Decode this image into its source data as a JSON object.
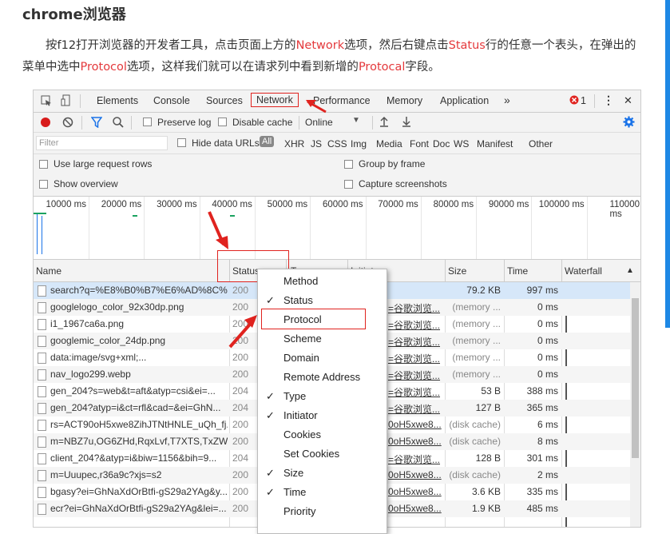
{
  "article": {
    "title": "chrome浏览器",
    "para": [
      {
        "t": "按f12打开浏览器的开发者工具，点击页面上方的",
        "hl": false
      },
      {
        "t": "Network",
        "hl": true
      },
      {
        "t": "选项，然后右键点击",
        "hl": false
      },
      {
        "t": "Status",
        "hl": true
      },
      {
        "t": "行的任意一个表头，在弹出的菜单中选中",
        "hl": false
      },
      {
        "t": "Protocol",
        "hl": true
      },
      {
        "t": "选项，这样我们就可以在请求列中看到新增的",
        "hl": false
      },
      {
        "t": "Protocal",
        "hl": true
      },
      {
        "t": "字段。",
        "hl": false
      }
    ]
  },
  "devtools": {
    "tabs": [
      "Elements",
      "Console",
      "Sources",
      "Network",
      "Performance",
      "Memory",
      "Application"
    ],
    "more_tabs": "»",
    "error_count": "1",
    "menu_icon": "⋮",
    "close_icon": "✕",
    "toolbar": {
      "preserve_log": "Preserve log",
      "disable_cache": "Disable cache",
      "throttle": "Online"
    },
    "filter": {
      "placeholder": "Filter",
      "hide_data_urls": "Hide data URLs",
      "all": "All",
      "types": [
        "XHR",
        "JS",
        "CSS",
        "Img",
        "Media",
        "Font",
        "Doc",
        "WS",
        "Manifest",
        "Other"
      ]
    },
    "options": {
      "large_rows": "Use large request rows",
      "show_overview": "Show overview",
      "group_by_frame": "Group by frame",
      "capture_screenshots": "Capture screenshots"
    },
    "ticks": [
      "10000 ms",
      "20000 ms",
      "30000 ms",
      "40000 ms",
      "50000 ms",
      "60000 ms",
      "70000 ms",
      "80000 ms",
      "90000 ms",
      "100000 ms",
      "110000 ms"
    ],
    "columns": {
      "name": "Name",
      "status": "Status",
      "type": "Ty",
      "initiator": "Initiator",
      "size": "Size",
      "time": "Time",
      "waterfall": "Waterfall"
    },
    "rows": [
      {
        "name": "search?q=%E8%B0%B7%E6%AD%8C%...",
        "status": "200",
        "init": "",
        "size": "79.2 KB",
        "time": "997 ms"
      },
      {
        "name": "googlelogo_color_92x30dp.png",
        "status": "200",
        "init": "=谷歌浏览...",
        "size": "(memory ...",
        "time": "0 ms"
      },
      {
        "name": "i1_1967ca6a.png",
        "status": "200",
        "init": "=谷歌浏览...",
        "size": "(memory ...",
        "time": "0 ms"
      },
      {
        "name": "googlemic_color_24dp.png",
        "status": "200",
        "init": "=谷歌浏览...",
        "size": "(memory ...",
        "time": "0 ms"
      },
      {
        "name": "data:image/svg+xml;...",
        "status": "200",
        "init": "=谷歌浏览...",
        "size": "(memory ...",
        "time": "0 ms"
      },
      {
        "name": "nav_logo299.webp",
        "status": "200",
        "init": "=谷歌浏览...",
        "size": "(memory ...",
        "time": "0 ms"
      },
      {
        "name": "gen_204?s=web&t=aft&atyp=csi&ei=...",
        "status": "204",
        "init": "=谷歌浏览...",
        "size": "53 B",
        "time": "388 ms"
      },
      {
        "name": "gen_204?atyp=i&ct=rfl&cad=&ei=GhN...",
        "status": "204",
        "init": "=谷歌浏览...",
        "size": "127 B",
        "time": "365 ms"
      },
      {
        "name": "rs=ACT90oH5xwe8ZihJTNtHNLE_uQh_fj...",
        "status": "200",
        "init": "0oH5xwe8...",
        "size": "(disk cache)",
        "time": "6 ms"
      },
      {
        "name": "m=NBZ7u,OG6ZHd,RqxLvf,T7XTS,TxZW...",
        "status": "200",
        "init": "0oH5xwe8...",
        "size": "(disk cache)",
        "time": "8 ms"
      },
      {
        "name": "client_204?&atyp=i&biw=1156&bih=9...",
        "status": "204",
        "init": "=谷歌浏览...",
        "size": "128 B",
        "time": "301 ms"
      },
      {
        "name": "m=Uuupec,r36a9c?xjs=s2",
        "status": "200",
        "init": "0oH5xwe8...",
        "size": "(disk cache)",
        "time": "2 ms"
      },
      {
        "name": "bgasy?ei=GhNaXdOrBtfi-gS29a2YAg&y...",
        "status": "200",
        "init": "0oH5xwe8...",
        "size": "3.6 KB",
        "time": "335 ms"
      },
      {
        "name": "ecr?ei=GhNaXdOrBtfi-gS29a2YAg&lei=...",
        "status": "200",
        "init": "0oH5xwe8...",
        "size": "1.9 KB",
        "time": "485 ms"
      }
    ]
  },
  "context_menu": [
    {
      "label": "Method",
      "checked": false
    },
    {
      "label": "Status",
      "checked": true
    },
    {
      "label": "Protocol",
      "checked": false
    },
    {
      "label": "Scheme",
      "checked": false
    },
    {
      "label": "Domain",
      "checked": false
    },
    {
      "label": "Remote Address",
      "checked": false
    },
    {
      "label": "Type",
      "checked": true
    },
    {
      "label": "Initiator",
      "checked": true
    },
    {
      "label": "Cookies",
      "checked": false
    },
    {
      "label": "Set Cookies",
      "checked": false
    },
    {
      "label": "Size",
      "checked": true
    },
    {
      "label": "Time",
      "checked": true
    },
    {
      "label": "Priority",
      "checked": false
    }
  ],
  "colors": {
    "highlight": "#e4393c",
    "annotation": "#e0231f",
    "accent_blue": "#1a73e8"
  }
}
